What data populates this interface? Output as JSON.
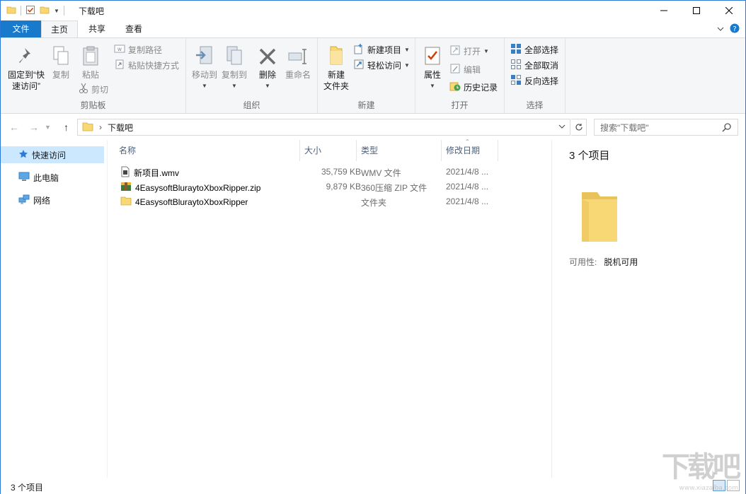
{
  "window": {
    "title": "下载吧"
  },
  "tabs": {
    "file": "文件",
    "home": "主页",
    "share": "共享",
    "view": "查看"
  },
  "ribbon": {
    "clipboard": {
      "label": "剪贴板",
      "pin": "固定到“快速访问”",
      "pin_line1": "固定到“快",
      "pin_line2": "速访问”",
      "copy": "复制",
      "paste": "粘贴",
      "copy_path": "复制路径",
      "paste_shortcut": "粘贴快捷方式",
      "cut": "剪切"
    },
    "organize": {
      "label": "组织",
      "move_to": "移动到",
      "copy_to": "复制到",
      "delete": "删除",
      "rename": "重命名"
    },
    "new": {
      "label": "新建",
      "new_folder_line1": "新建",
      "new_folder_line2": "文件夹",
      "new_item": "新建项目",
      "easy_access": "轻松访问"
    },
    "open": {
      "label": "打开",
      "properties": "属性",
      "open": "打开",
      "edit": "编辑",
      "history": "历史记录"
    },
    "select": {
      "label": "选择",
      "select_all": "全部选择",
      "select_none": "全部取消",
      "invert": "反向选择"
    }
  },
  "address": {
    "path": "下载吧",
    "search_placeholder": "搜索\"下载吧\""
  },
  "nav": {
    "quick_access": "快速访问",
    "this_pc": "此电脑",
    "network": "网络"
  },
  "columns": {
    "name": "名称",
    "size": "大小",
    "type": "类型",
    "modified": "修改日期"
  },
  "files": [
    {
      "name": "新项目.wmv",
      "size": "35,759 KB",
      "type": "WMV 文件",
      "modified": "2021/4/8 ..."
    },
    {
      "name": "4EasysoftBluraytoXboxRipper.zip",
      "size": "9,879 KB",
      "type": "360压缩 ZIP 文件",
      "modified": "2021/4/8 ..."
    },
    {
      "name": "4EasysoftBluraytoXboxRipper",
      "size": "",
      "type": "文件夹",
      "modified": "2021/4/8 ..."
    }
  ],
  "details": {
    "count": "3 个项目",
    "availability_label": "可用性:",
    "availability_value": "脱机可用"
  },
  "status": {
    "count": "3 个项目"
  },
  "watermark": {
    "main": "下载吧",
    "sub": "www.xiazaiba.com"
  },
  "colors": {
    "accent": "#1979ca",
    "selection": "#cce8ff",
    "folder": "#f8d775"
  }
}
